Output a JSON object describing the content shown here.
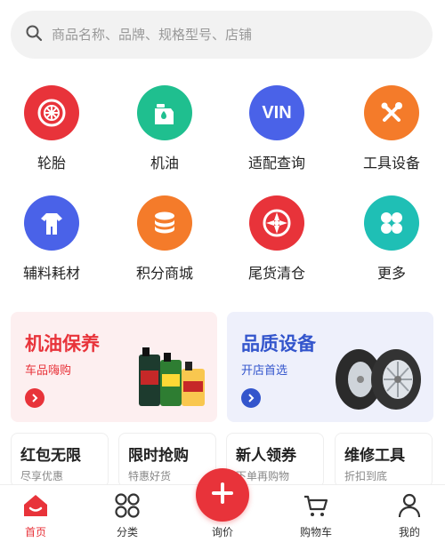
{
  "search": {
    "placeholder": "商品名称、品牌、规格型号、店铺"
  },
  "categories": [
    {
      "label": "轮胎",
      "icon": "tire-icon",
      "color": "#e8333a"
    },
    {
      "label": "机油",
      "icon": "oil-can-icon",
      "color": "#1fbf8f"
    },
    {
      "label": "适配查询",
      "icon": "vin-icon",
      "color": "#4a62e8",
      "badge": "VIN"
    },
    {
      "label": "工具设备",
      "icon": "tools-icon",
      "color": "#f47b2a"
    },
    {
      "label": "辅料耗材",
      "icon": "coverall-icon",
      "color": "#4a62e8"
    },
    {
      "label": "积分商城",
      "icon": "coins-icon",
      "color": "#f47b2a"
    },
    {
      "label": "尾货清仓",
      "icon": "wheel-icon",
      "color": "#e8333a"
    },
    {
      "label": "更多",
      "icon": "more-icon",
      "color": "#1fbfb5"
    }
  ],
  "promos": [
    {
      "title": "机油保养",
      "subtitle": "车品嗨购",
      "color": "#e8333a",
      "bg": "#fdeff0"
    },
    {
      "title": "品质设备",
      "subtitle": "开店首选",
      "color": "#3355cc",
      "bg": "#eef0fb"
    }
  ],
  "deals": [
    {
      "title": "红包无限",
      "subtitle": "尽享优惠"
    },
    {
      "title": "限时抢购",
      "subtitle": "特惠好货"
    },
    {
      "title": "新人领券",
      "subtitle": "下单再购物"
    },
    {
      "title": "维修工具",
      "subtitle": "折扣到底"
    }
  ],
  "tabs": [
    {
      "label": "首页",
      "icon": "home-icon",
      "active": true
    },
    {
      "label": "分类",
      "icon": "category-icon",
      "active": false
    },
    {
      "label": "询价",
      "icon": "plus-icon",
      "active": false
    },
    {
      "label": "购物车",
      "icon": "cart-icon",
      "active": false
    },
    {
      "label": "我的",
      "icon": "user-icon",
      "active": false
    }
  ],
  "theme": {
    "accent": "#e8333a"
  }
}
